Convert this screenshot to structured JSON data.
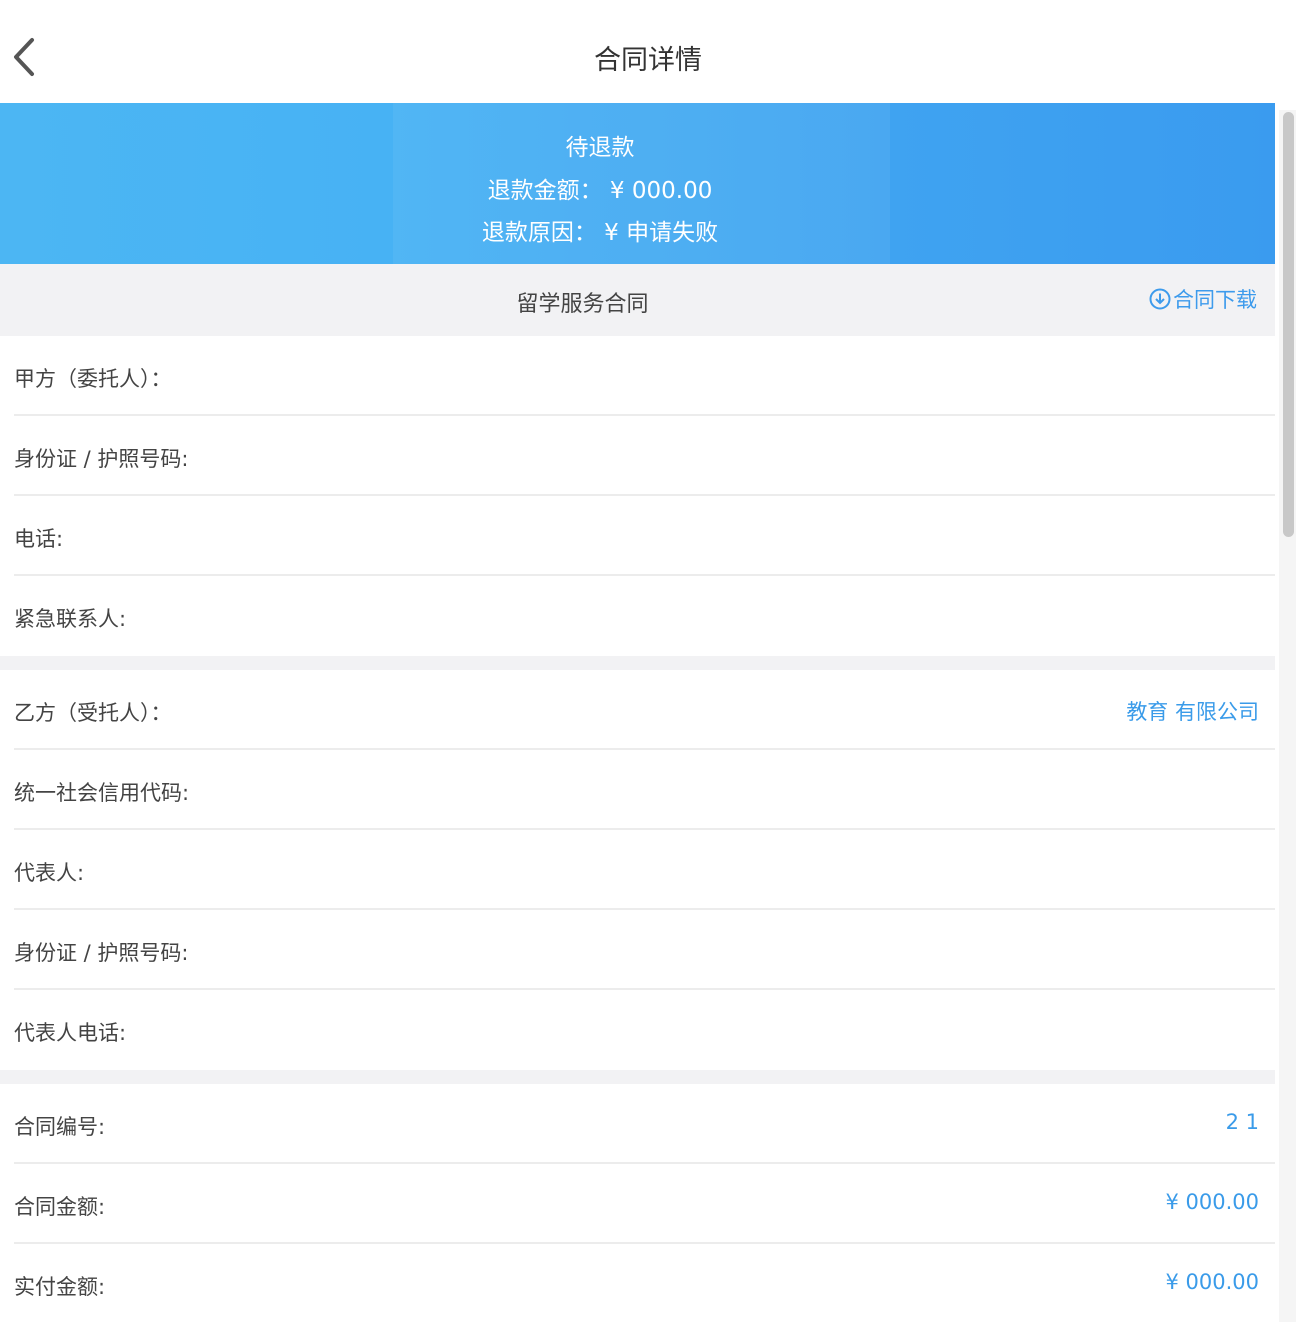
{
  "header": {
    "title": "合同详情",
    "back_icon": "chevron-left-icon"
  },
  "banner": {
    "status": "待退款",
    "refund_amount": "退款金额： ¥ 000.00",
    "refund_reason": "退款原因： ¥ 申请失败"
  },
  "section": {
    "title": "留学服务合同",
    "download_label": "合同下载",
    "download_icon": "download-circle-icon"
  },
  "party_a": [
    {
      "label": "甲方（委托人）：",
      "value": ""
    },
    {
      "label": "身份证 / 护照号码:",
      "value": ""
    },
    {
      "label": "电话:",
      "value": ""
    },
    {
      "label": "紧急联系人:",
      "value": ""
    }
  ],
  "party_b": [
    {
      "label": "乙方（受托人）：",
      "value": "教育 有限公司"
    },
    {
      "label": "统一社会信用代码:",
      "value": ""
    },
    {
      "label": "代表人:",
      "value": ""
    },
    {
      "label": "身份证 / 护照号码:",
      "value": ""
    },
    {
      "label": "代表人电话:",
      "value": ""
    }
  ],
  "contract": [
    {
      "label": "合同编号:",
      "value": "2 1"
    },
    {
      "label": "合同金额:",
      "value": "¥ 000.00"
    },
    {
      "label": "实付金额:",
      "value": "¥ 000.00"
    }
  ],
  "colors": {
    "banner": "#3fa3f1",
    "accent": "#3a9be9",
    "section_bg": "#f2f2f4"
  }
}
